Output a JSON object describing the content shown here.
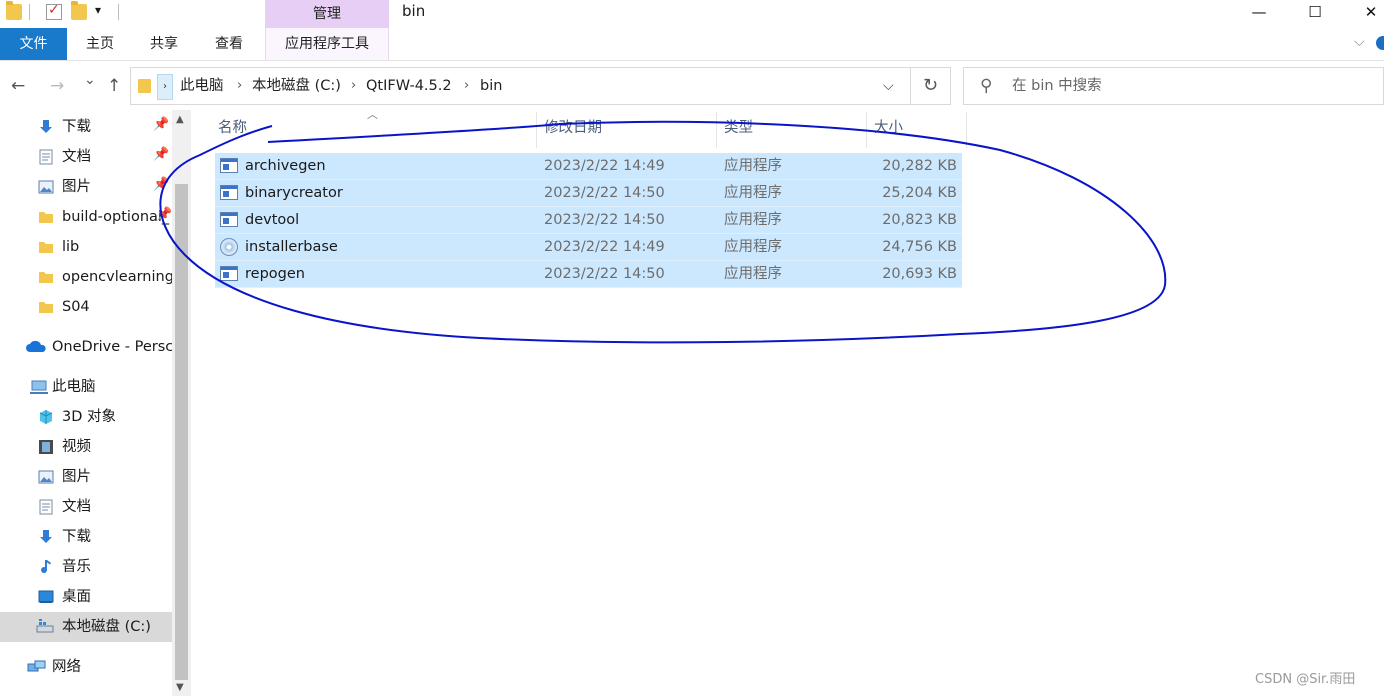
{
  "window": {
    "title": "bin",
    "contextual_group": "管理",
    "controls": {
      "minimize": "—",
      "maximize": "☐",
      "close": "✕"
    }
  },
  "ribbon": {
    "tabs": [
      {
        "label": "文件",
        "active": true
      },
      {
        "label": "主页"
      },
      {
        "label": "共享"
      },
      {
        "label": "查看"
      },
      {
        "label": "应用程序工具"
      }
    ]
  },
  "nav": {
    "back": "←",
    "forward": "→",
    "recent": "⌄",
    "up": "↑",
    "breadcrumb": [
      "此电脑",
      "本地磁盘 (C:)",
      "QtIFW-4.5.2",
      "bin"
    ],
    "separator": "›",
    "refresh": "↻",
    "search_placeholder": "在 bin 中搜索"
  },
  "sidebar": {
    "items": [
      {
        "label": "下载",
        "icon": "download-icon",
        "pinned": true
      },
      {
        "label": "文档",
        "icon": "document-icon",
        "pinned": true
      },
      {
        "label": "图片",
        "icon": "pictures-icon",
        "pinned": true
      },
      {
        "label": "build-optional_",
        "icon": "folder-icon",
        "pinned": true
      },
      {
        "label": "lib",
        "icon": "folder-icon"
      },
      {
        "label": "opencvlearning",
        "icon": "folder-icon"
      },
      {
        "label": "S04",
        "icon": "folder-icon"
      },
      {
        "label": "OneDrive - Persc",
        "icon": "onedrive-icon"
      },
      {
        "label": "此电脑",
        "icon": "this-pc-icon"
      },
      {
        "label": "3D 对象",
        "icon": "3d-objects-icon"
      },
      {
        "label": "视频",
        "icon": "videos-icon"
      },
      {
        "label": "图片",
        "icon": "pictures-icon"
      },
      {
        "label": "文档",
        "icon": "document-icon"
      },
      {
        "label": "下载",
        "icon": "download-icon"
      },
      {
        "label": "音乐",
        "icon": "music-icon"
      },
      {
        "label": "桌面",
        "icon": "desktop-icon"
      },
      {
        "label": "本地磁盘 (C:)",
        "icon": "drive-icon",
        "selected": true
      },
      {
        "label": "网络",
        "icon": "network-icon"
      }
    ]
  },
  "filelist": {
    "columns": [
      "名称",
      "修改日期",
      "类型",
      "大小"
    ],
    "rows": [
      {
        "name": "archivegen",
        "date": "2023/2/22 14:49",
        "type": "应用程序",
        "size": "20,282 KB",
        "icon": "exe-icon"
      },
      {
        "name": "binarycreator",
        "date": "2023/2/22 14:50",
        "type": "应用程序",
        "size": "25,204 KB",
        "icon": "exe-icon"
      },
      {
        "name": "devtool",
        "date": "2023/2/22 14:50",
        "type": "应用程序",
        "size": "20,823 KB",
        "icon": "exe-icon"
      },
      {
        "name": "installerbase",
        "date": "2023/2/22 14:49",
        "type": "应用程序",
        "size": "24,756 KB",
        "icon": "installer-icon"
      },
      {
        "name": "repogen",
        "date": "2023/2/22 14:50",
        "type": "应用程序",
        "size": "20,693 KB",
        "icon": "exe-icon"
      }
    ]
  },
  "watermark": "CSDN @Sir.雨田",
  "colors": {
    "accent": "#1979ca",
    "selection": "#cce8ff",
    "context_tab": "#e6cef5",
    "annotation": "#0a14c8"
  }
}
